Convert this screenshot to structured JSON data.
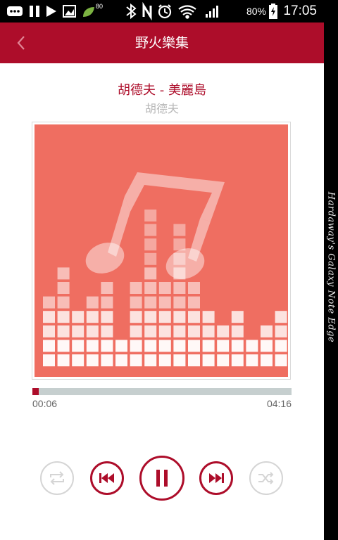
{
  "status_bar": {
    "time": "17:05",
    "battery_percent": "80%",
    "notification_badge": "80"
  },
  "header": {
    "title": "野火樂集"
  },
  "track": {
    "title": "胡德夫 - 美麗島",
    "artist": "胡德夫"
  },
  "playback": {
    "current_time": "00:06",
    "total_time": "04:16",
    "progress": 0.024,
    "state": "playing"
  },
  "device_edge_text": "Hardaway's Galaxy Note Edge",
  "colors": {
    "accent": "#ad0d2a",
    "album_bg": "#ef6e61",
    "inactive": "#d5d5d5",
    "track": "#c6cfcf"
  },
  "icons": {
    "back": "chevron-left-icon",
    "repeat": "repeat-icon",
    "previous": "skip-previous-icon",
    "play_pause": "pause-icon",
    "next": "skip-next-icon",
    "shuffle": "shuffle-icon"
  }
}
